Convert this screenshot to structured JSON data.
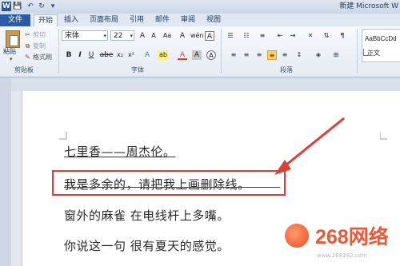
{
  "titlebar": {
    "word_icon": "W",
    "qa_save": "💾",
    "qa_undo": "↶",
    "qa_redo": "↻",
    "qa_more": "▾",
    "document_title": "新建 Microsoft W"
  },
  "tabs": [
    "文件",
    "开始",
    "插入",
    "页面布局",
    "引用",
    "邮件",
    "审阅",
    "视图"
  ],
  "clipboard": {
    "paste": "粘贴",
    "cut": "剪切",
    "copy": "复制",
    "format_painter": "格式刷",
    "group_label": "剪贴板"
  },
  "font": {
    "name": "宋体",
    "size": "22",
    "group_label": "字体",
    "grow": "A",
    "shrink": "A",
    "case": "Aa",
    "clear": "A",
    "phonetic": "wén",
    "border": "A",
    "bold": "B",
    "italic": "I",
    "underline": "U",
    "strike": "abe",
    "sub": "x₂",
    "sup": "x²",
    "effect": "A",
    "highlight": "ab",
    "color": "A",
    "shade": "A",
    "circle": "A"
  },
  "paragraph": {
    "group_label": "段落"
  },
  "styles": {
    "style_name": "AaBbCcDd",
    "style_label": "正文"
  },
  "document": {
    "lines": [
      "七里香——周杰伦。",
      "我是多余的，请把我上画删除线。",
      "窗外的麻雀  在电线杆上多嘴。",
      "你说这一句  很有夏天的感觉。"
    ],
    "accent_color": "#d9403b"
  },
  "watermark": {
    "brand": "268网络",
    "url": "www.268282.com"
  }
}
